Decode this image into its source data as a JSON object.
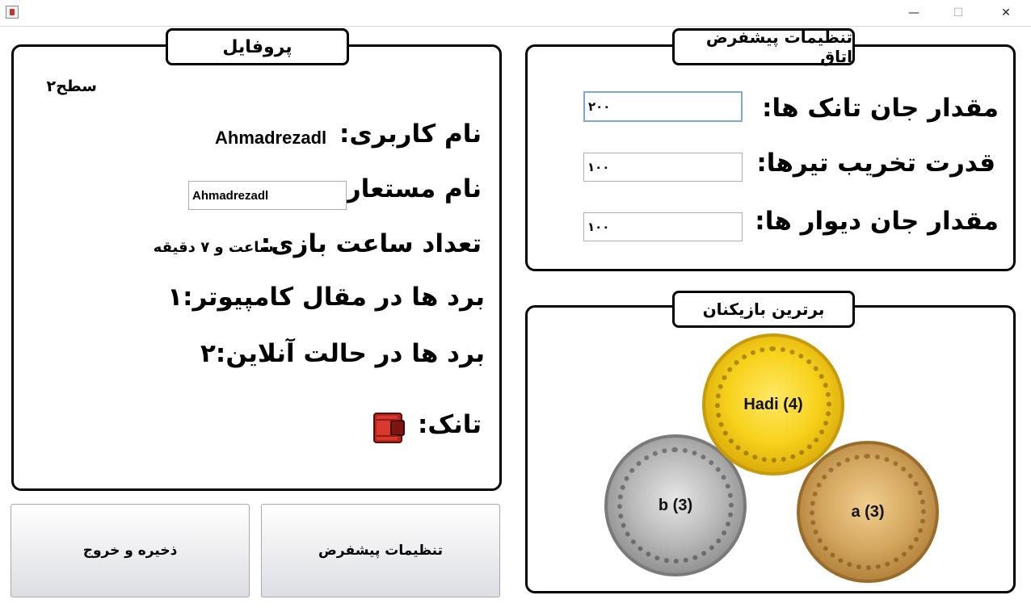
{
  "window": {
    "icon": "java-cup-icon",
    "controls": {
      "minimize": "—",
      "maximize": "☐",
      "close": "✕"
    }
  },
  "profile": {
    "title": "پروفایل",
    "level": "سطح۲",
    "username_label": "نام کاربری:",
    "username_value": "Ahmadrezadl",
    "alias_label": "نام مستعار:",
    "alias_value": "Ahmadrezadl",
    "playtime_label": "تعداد ساعت بازی:",
    "playtime_value": "۰ ساعت و ۷ دقیقه",
    "wins_computer_label": "برد ها در مقال کامپیوتر:",
    "wins_computer_value": "۱",
    "wins_online_label": "برد ها در حالت آنلاین:",
    "wins_online_value": "۲",
    "tank_label": "تانک:",
    "tank_icon": "red-tank-icon"
  },
  "buttons": {
    "save_exit": "ذخیره و خروج",
    "default_settings": "تنظیمات پیشفرض"
  },
  "room_settings": {
    "title": "تنظیمات پیشفرض اتاق",
    "tank_hp_label": "مقدار جان تانک ها:",
    "tank_hp_value": "۲۰۰",
    "bullet_damage_label": "قدرت تخریب تیرها:",
    "bullet_damage_value": "۱۰۰",
    "wall_hp_label": "مقدار جان دیوار ها:",
    "wall_hp_value": "۱۰۰"
  },
  "top_players": {
    "title": "برترین بازیکنان",
    "first": "Hadi (4)",
    "second": "b (3)",
    "third": "a (3)",
    "colors": {
      "gold": "#f7d21c",
      "silver": "#b8b8b8",
      "bronze": "#d4a660"
    }
  }
}
